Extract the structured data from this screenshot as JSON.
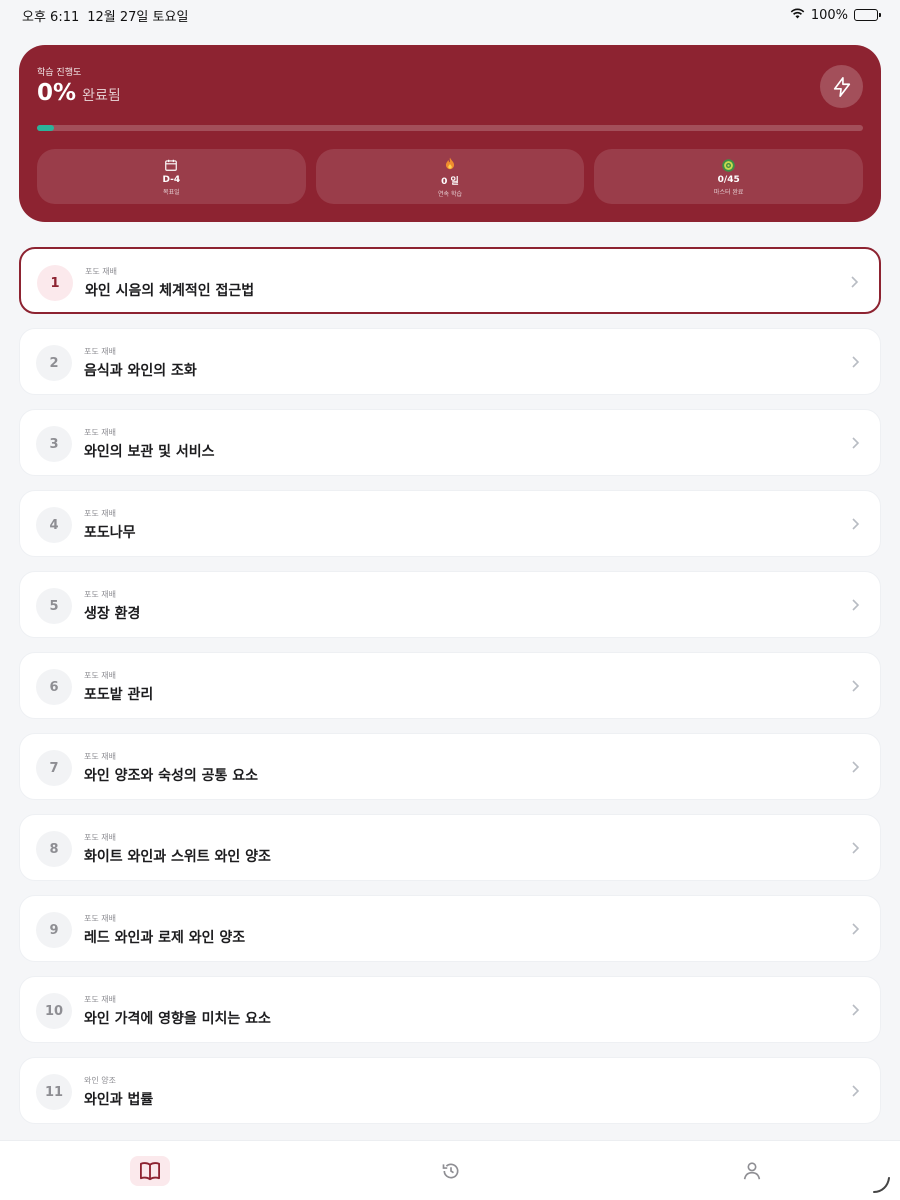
{
  "status_bar": {
    "time": "오후 6:11",
    "date": "12월 27일 토요일",
    "battery": "100%"
  },
  "progress": {
    "label": "학습 진행도",
    "percent": "0%",
    "percent_suffix": "완료됨",
    "fill_fraction": 0.02,
    "stats": [
      {
        "icon": "calendar-icon",
        "value": "D-4",
        "label": "목표일"
      },
      {
        "icon": "flame-icon",
        "value": "0 일",
        "label": "연속 학습"
      },
      {
        "icon": "target-icon",
        "value": "0/45",
        "label": "마스터 완료"
      }
    ]
  },
  "lessons": [
    {
      "num": "1",
      "category": "포도 재배",
      "title": "와인 시음의 체계적인 접근법",
      "active": true
    },
    {
      "num": "2",
      "category": "포도 재배",
      "title": "음식과 와인의 조화"
    },
    {
      "num": "3",
      "category": "포도 재배",
      "title": "와인의 보관 및 서비스"
    },
    {
      "num": "4",
      "category": "포도 재배",
      "title": "포도나무"
    },
    {
      "num": "5",
      "category": "포도 재배",
      "title": "생장 환경"
    },
    {
      "num": "6",
      "category": "포도 재배",
      "title": "포도밭 관리"
    },
    {
      "num": "7",
      "category": "포도 재배",
      "title": "와인 양조와 숙성의 공통 요소"
    },
    {
      "num": "8",
      "category": "포도 재배",
      "title": "화이트 와인과 스위트 와인 양조"
    },
    {
      "num": "9",
      "category": "포도 재배",
      "title": "레드 와인과 로제 와인 양조"
    },
    {
      "num": "10",
      "category": "포도 재배",
      "title": "와인 가격에 영향을 미치는 요소"
    },
    {
      "num": "11",
      "category": "와인 양조",
      "title": "와인과 법률"
    }
  ],
  "tabs": [
    {
      "icon": "book-icon",
      "active": true
    },
    {
      "icon": "history-icon"
    },
    {
      "icon": "person-icon"
    }
  ],
  "colors": {
    "accent": "#8d2331",
    "progress_fill": "#2bb39a",
    "background": "#f5f6f8"
  }
}
